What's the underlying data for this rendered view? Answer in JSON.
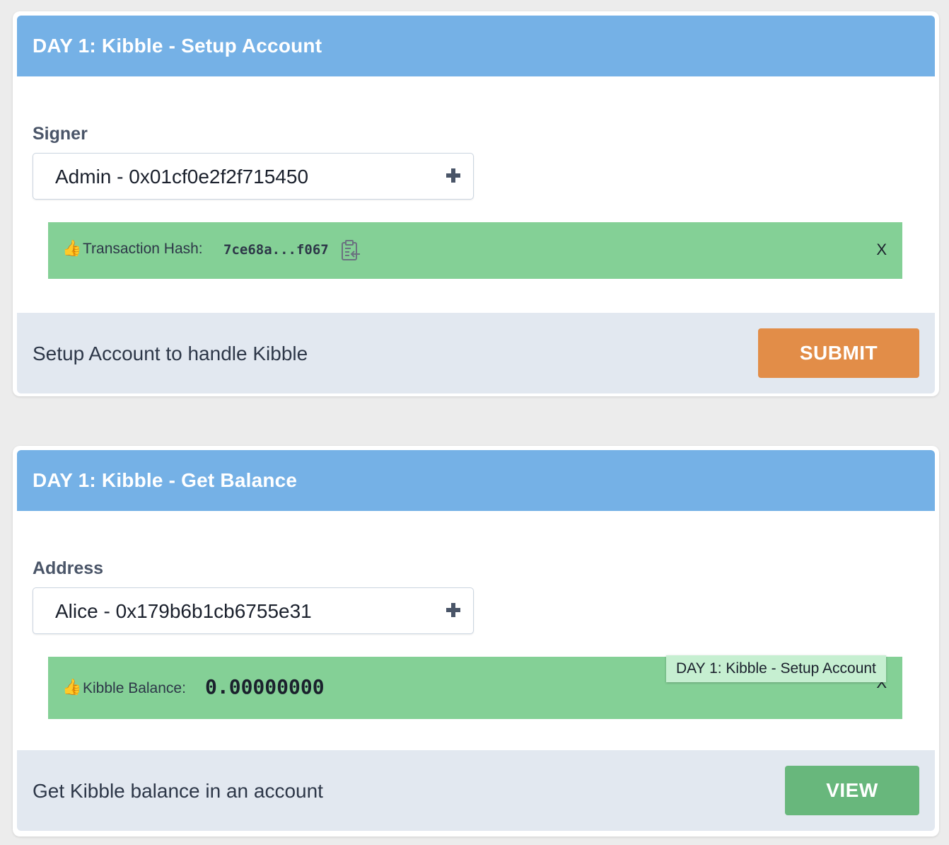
{
  "cards": [
    {
      "title": "DAY 1: Kibble - Setup Account",
      "field_label": "Signer",
      "select_value": "Admin - 0x01cf0e2f2f715450",
      "result": {
        "emoji": "👍",
        "label": "Transaction Hash:",
        "value": "7ce68a...f067",
        "icon": "clipboard-copy-icon",
        "close": "X"
      },
      "description": "Setup Account to handle Kibble",
      "button": "SUBMIT",
      "button_color": "#e28d48"
    },
    {
      "title": "DAY 1: Kibble - Get Balance",
      "field_label": "Address",
      "select_value": "Alice - 0x179b6b1cb6755e31",
      "result": {
        "emoji": "👍",
        "label": "Kibble Balance:",
        "value": "0.00000000",
        "close": "X"
      },
      "description": "Get Kibble balance in an account",
      "button": "VIEW",
      "button_color": "#68b77c"
    }
  ],
  "tooltip": "DAY 1: Kibble - Setup Account",
  "colors": {
    "header": "#75b1e6",
    "alert": "#84d096",
    "footer": "#e2e8f0",
    "background": "#ececec"
  }
}
